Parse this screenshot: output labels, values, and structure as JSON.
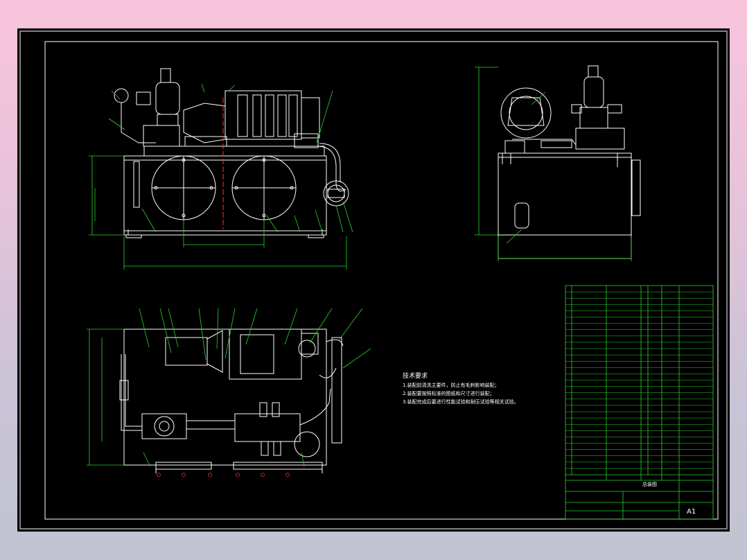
{
  "drawing": {
    "colors": {
      "outline": "#ffffff",
      "annotation": "#2bd62b",
      "dimension": "#2bd62b",
      "centerline": "#ff3030",
      "titleblock": "#2bd62b",
      "background": "#000000"
    },
    "technical_requirements": {
      "heading": "技术要求",
      "items": [
        "1.装配前清洗主要件，防止有毛刺影响装配；",
        "2.装配要按照标准的图纸和尺寸进行装配；",
        "3.装配完成后要进行性能试验和耐压试验等相关试验。"
      ]
    },
    "title_block": {
      "assembly_name": "总装图",
      "scale_label": "A1"
    }
  }
}
